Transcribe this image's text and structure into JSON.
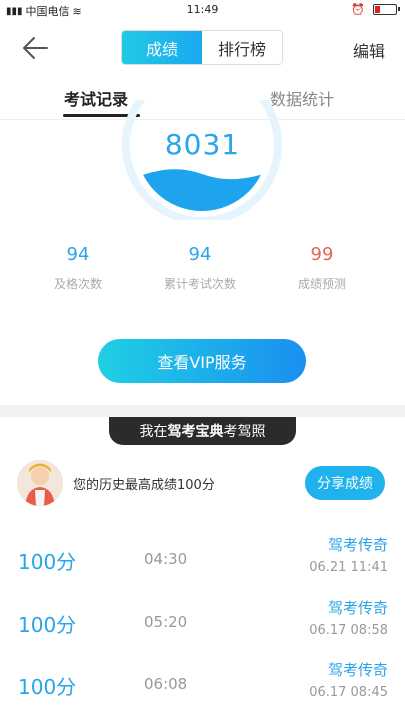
{
  "status_bar": {
    "carrier": "中国电信",
    "time": "11:49"
  },
  "nav": {
    "tabs": [
      "成绩",
      "排行榜"
    ],
    "edit_label": "编辑"
  },
  "sub_tabs": [
    "考试记录",
    "数据统计"
  ],
  "gauge": {
    "score": "8031",
    "fill_level": 0.35
  },
  "stats": [
    {
      "value": "94",
      "label": "及格次数",
      "color": "#2aa4ea"
    },
    {
      "value": "94",
      "label": "累计考试次数",
      "color": "#2aa4ea"
    },
    {
      "value": "99",
      "label": "成绩预测",
      "color": "#e0675a"
    }
  ],
  "vip_button": "查看VIP服务",
  "promo": {
    "prefix": "我在",
    "brand": "驾考宝典",
    "suffix": "考驾照"
  },
  "history": {
    "best_text": "您的历史最高成绩100分",
    "share_label": "分享成绩"
  },
  "records": [
    {
      "score": "100分",
      "duration": "04:30",
      "title": "驾考传奇",
      "date": "06.21  11:41"
    },
    {
      "score": "100分",
      "duration": "05:20",
      "title": "驾考传奇",
      "date": "06.17  08:58"
    },
    {
      "score": "100分",
      "duration": "06:08",
      "title": "驾考传奇",
      "date": "06.17  08:45"
    }
  ]
}
